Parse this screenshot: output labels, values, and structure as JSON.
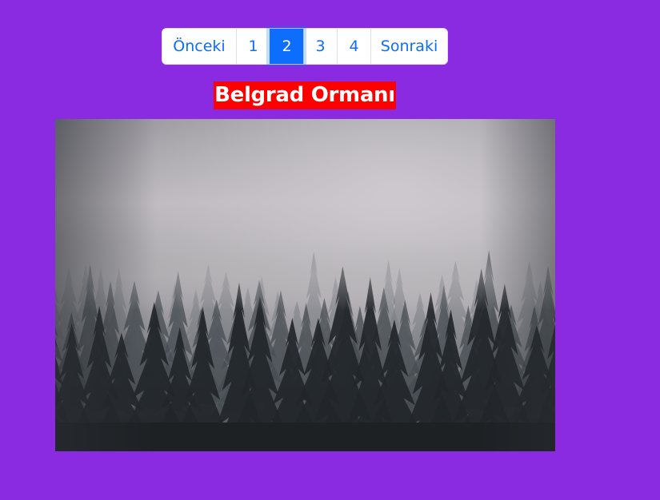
{
  "colors": {
    "background": "#8a2be2",
    "title_bg": "#ff0000",
    "title_text": "#ffffff",
    "link": "#0d6efd",
    "active_bg": "#0d6efd"
  },
  "pagination": {
    "previous_label": "Önceki",
    "pages": [
      "1",
      "2",
      "3",
      "4"
    ],
    "active_page": "2",
    "next_label": "Sonraki"
  },
  "title": "Belgrad Ormanı",
  "photo": {
    "subject": "misty pine forest"
  }
}
